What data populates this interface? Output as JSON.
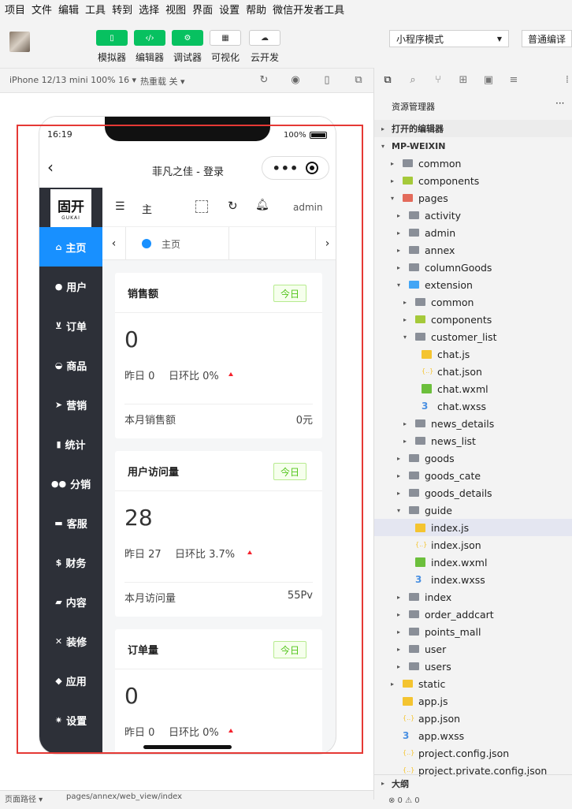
{
  "menu": [
    "项目",
    "文件",
    "编辑",
    "工具",
    "转到",
    "选择",
    "视图",
    "界面",
    "设置",
    "帮助",
    "微信开发者工具"
  ],
  "toolbar": {
    "buttons": [
      {
        "label": "模拟器",
        "icon": "phone-icon"
      },
      {
        "label": "编辑器",
        "icon": "code-icon"
      },
      {
        "label": "调试器",
        "icon": "debug-icon"
      },
      {
        "label": "可视化",
        "icon": "layout-icon"
      },
      {
        "label": "云开发",
        "icon": "cloud-icon"
      }
    ],
    "mode": "小程序模式",
    "compile": "普通编译"
  },
  "simbar": {
    "device": "iPhone 12/13 mini 100% 16 ▾",
    "hotreload": "热重载 关 ▾"
  },
  "phone": {
    "status": {
      "time": "16:19",
      "battery": "100%"
    },
    "nav_title": "菲凡之佳 - 登录",
    "logo": {
      "main": "固开",
      "sub": "GUKAI"
    },
    "sidebar": [
      {
        "label": "主页",
        "icon": "home-icon",
        "active": true
      },
      {
        "label": "用户",
        "icon": "user-icon"
      },
      {
        "label": "订单",
        "icon": "cart-icon"
      },
      {
        "label": "商品",
        "icon": "basket-icon"
      },
      {
        "label": "营销",
        "icon": "send-icon"
      },
      {
        "label": "统计",
        "icon": "bar-chart-icon"
      },
      {
        "label": "分销",
        "icon": "group-icon"
      },
      {
        "label": "客服",
        "icon": "chat-icon"
      },
      {
        "label": "财务",
        "icon": "dollar-icon"
      },
      {
        "label": "内容",
        "icon": "book-icon"
      },
      {
        "label": "装修",
        "icon": "tools-icon"
      },
      {
        "label": "应用",
        "icon": "cube-icon"
      },
      {
        "label": "设置",
        "icon": "gear-icon"
      }
    ],
    "topbar": {
      "menu_label": "主",
      "user": "admin"
    },
    "tab": {
      "label": "主页"
    },
    "cards": [
      {
        "title": "销售额",
        "tag": "今日",
        "value": "0",
        "yesterday": "昨日 0",
        "rate": "日环比 0%",
        "month_label": "本月销售额",
        "month_value": "0元"
      },
      {
        "title": "用户访问量",
        "tag": "今日",
        "value": "28",
        "yesterday": "昨日 27",
        "rate": "日环比 3.7%",
        "month_label": "本月访问量",
        "month_value": "55Pv"
      },
      {
        "title": "订单量",
        "tag": "今日",
        "value": "0",
        "yesterday": "昨日 0",
        "rate": "日环比 0%"
      }
    ]
  },
  "explorer": {
    "title": "资源管理器",
    "open_editors": "打开的编辑器",
    "root": "MP-WEIXIN",
    "tree": [
      {
        "label": "common",
        "depth": 1,
        "arrow": "▸",
        "type": "folder"
      },
      {
        "label": "components",
        "depth": 1,
        "arrow": "▸",
        "type": "folder-green"
      },
      {
        "label": "pages",
        "depth": 1,
        "arrow": "▾",
        "type": "folder-red"
      },
      {
        "label": "activity",
        "depth": 2,
        "arrow": "▸",
        "type": "folder"
      },
      {
        "label": "admin",
        "depth": 2,
        "arrow": "▸",
        "type": "folder"
      },
      {
        "label": "annex",
        "depth": 2,
        "arrow": "▸",
        "type": "folder"
      },
      {
        "label": "columnGoods",
        "depth": 2,
        "arrow": "▸",
        "type": "folder"
      },
      {
        "label": "extension",
        "depth": 2,
        "arrow": "▾",
        "type": "folder-blue"
      },
      {
        "label": "common",
        "depth": 3,
        "arrow": "▸",
        "type": "folder"
      },
      {
        "label": "components",
        "depth": 3,
        "arrow": "▸",
        "type": "folder-green"
      },
      {
        "label": "customer_list",
        "depth": 3,
        "arrow": "▾",
        "type": "folder-open"
      },
      {
        "label": "chat.js",
        "depth": 4,
        "arrow": "",
        "type": "js"
      },
      {
        "label": "chat.json",
        "depth": 4,
        "arrow": "",
        "type": "json"
      },
      {
        "label": "chat.wxml",
        "depth": 4,
        "arrow": "",
        "type": "wxml"
      },
      {
        "label": "chat.wxss",
        "depth": 4,
        "arrow": "",
        "type": "wxss"
      },
      {
        "label": "news_details",
        "depth": 3,
        "arrow": "▸",
        "type": "folder"
      },
      {
        "label": "news_list",
        "depth": 3,
        "arrow": "▸",
        "type": "folder"
      },
      {
        "label": "goods",
        "depth": 2,
        "arrow": "▸",
        "type": "folder"
      },
      {
        "label": "goods_cate",
        "depth": 2,
        "arrow": "▸",
        "type": "folder"
      },
      {
        "label": "goods_details",
        "depth": 2,
        "arrow": "▸",
        "type": "folder"
      },
      {
        "label": "guide",
        "depth": 2,
        "arrow": "▾",
        "type": "folder-open"
      },
      {
        "label": "index.js",
        "depth": 3,
        "arrow": "",
        "type": "js",
        "selected": true
      },
      {
        "label": "index.json",
        "depth": 3,
        "arrow": "",
        "type": "json"
      },
      {
        "label": "index.wxml",
        "depth": 3,
        "arrow": "",
        "type": "wxml"
      },
      {
        "label": "index.wxss",
        "depth": 3,
        "arrow": "",
        "type": "wxss"
      },
      {
        "label": "index",
        "depth": 2,
        "arrow": "▸",
        "type": "folder"
      },
      {
        "label": "order_addcart",
        "depth": 2,
        "arrow": "▸",
        "type": "folder"
      },
      {
        "label": "points_mall",
        "depth": 2,
        "arrow": "▸",
        "type": "folder"
      },
      {
        "label": "user",
        "depth": 2,
        "arrow": "▸",
        "type": "folder"
      },
      {
        "label": "users",
        "depth": 2,
        "arrow": "▸",
        "type": "folder"
      },
      {
        "label": "static",
        "depth": 1,
        "arrow": "▸",
        "type": "folder-yellow"
      },
      {
        "label": "app.js",
        "depth": 1,
        "arrow": "",
        "type": "js"
      },
      {
        "label": "app.json",
        "depth": 1,
        "arrow": "",
        "type": "json"
      },
      {
        "label": "app.wxss",
        "depth": 1,
        "arrow": "",
        "type": "wxss"
      },
      {
        "label": "project.config.json",
        "depth": 1,
        "arrow": "",
        "type": "json"
      },
      {
        "label": "project.private.config.json",
        "depth": 1,
        "arrow": "",
        "type": "json"
      }
    ],
    "outline": "大纲"
  },
  "bottom": {
    "path_label": "页面路径 ▾",
    "path": "pages/annex/web_view/index"
  }
}
